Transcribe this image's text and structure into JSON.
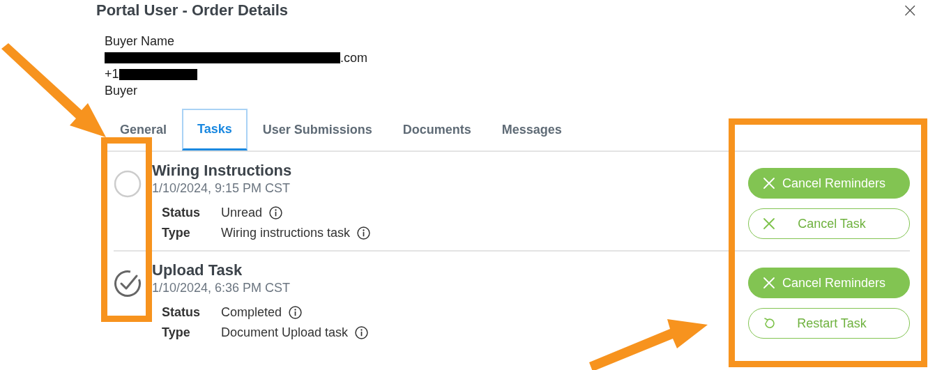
{
  "dialog": {
    "title": "Portal User - Order Details",
    "close": "×"
  },
  "buyer": {
    "lines": [
      {
        "parts": [
          {
            "kind": "text",
            "text": "Buyer Name"
          }
        ]
      },
      {
        "parts": [
          {
            "kind": "redacted"
          },
          {
            "kind": "text",
            "text": ".com"
          }
        ]
      },
      {
        "parts": [
          {
            "kind": "text",
            "text": "+1"
          },
          {
            "kind": "redacted"
          }
        ]
      },
      {
        "parts": [
          {
            "kind": "text",
            "text": "Buyer"
          }
        ]
      }
    ]
  },
  "tabs": [
    {
      "label": "General",
      "selected": false
    },
    {
      "label": "Tasks",
      "selected": true
    },
    {
      "label": "User Submissions",
      "selected": false
    },
    {
      "label": "Documents",
      "selected": false
    },
    {
      "label": "Messages",
      "selected": false
    }
  ],
  "tasks": [
    {
      "title": "Wiring Instructions",
      "date": "1/10/2024, 9:15 PM CST",
      "checked": false,
      "details": [
        {
          "label": "Status",
          "value": "Unread"
        },
        {
          "label": "Type",
          "value": "Wiring instructions task"
        }
      ],
      "buttons": [
        {
          "kind": "dismiss",
          "label": "Cancel Reminders"
        },
        {
          "kind": "cancel",
          "label": "Cancel Task"
        }
      ]
    },
    {
      "title": "Upload Task",
      "date": "1/10/2024, 6:36 PM CST",
      "checked": true,
      "details": [
        {
          "label": "Status",
          "value": "Completed"
        },
        {
          "label": "Type",
          "value": "Document Upload task"
        }
      ],
      "buttons": [
        {
          "kind": "dismiss",
          "label": "Cancel Reminders"
        },
        {
          "kind": "restart",
          "label": "Restart Task"
        }
      ]
    }
  ]
}
